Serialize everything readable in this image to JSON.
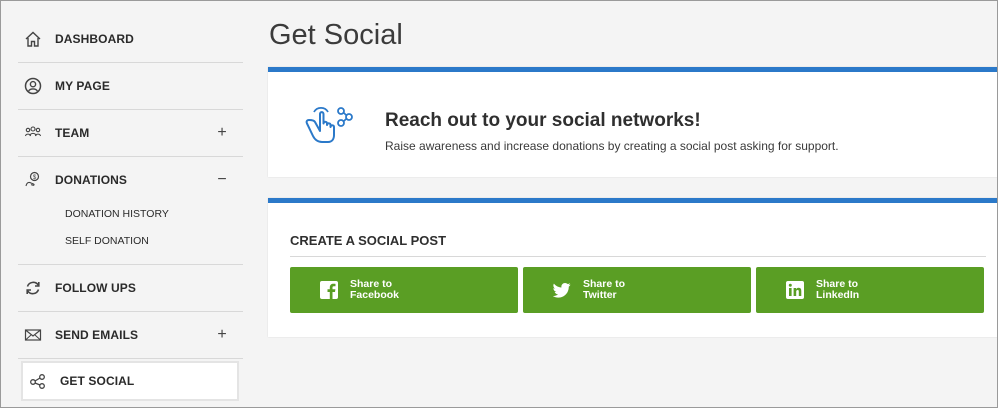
{
  "sidebar": {
    "items": [
      {
        "label": "DASHBOARD",
        "icon": "home-icon"
      },
      {
        "label": "MY PAGE",
        "icon": "user-circle-icon"
      },
      {
        "label": "TEAM",
        "icon": "team-icon",
        "toggle": "+"
      },
      {
        "label": "DONATIONS",
        "icon": "donation-icon",
        "toggle": "−"
      },
      {
        "label": "FOLLOW UPS",
        "icon": "refresh-icon"
      },
      {
        "label": "SEND EMAILS",
        "icon": "envelope-icon",
        "toggle": "+"
      },
      {
        "label": "GET SOCIAL",
        "icon": "share-icon"
      }
    ],
    "donation_subitems": [
      "DONATION HISTORY",
      "SELF DONATION"
    ]
  },
  "main": {
    "title": "Get Social",
    "reach": {
      "title": "Reach out to your social networks!",
      "subtitle": "Raise awareness and increase donations by creating a social post asking for support."
    },
    "create": {
      "title": "CREATE A SOCIAL POST",
      "buttons": [
        {
          "line1": "Share to",
          "line2": "Facebook",
          "icon": "facebook-icon"
        },
        {
          "line1": "Share to",
          "line2": "Twitter",
          "icon": "twitter-icon"
        },
        {
          "line1": "Share to",
          "line2": "LinkedIn",
          "icon": "linkedin-icon"
        }
      ]
    }
  },
  "colors": {
    "accent_blue": "#2b79c9",
    "share_green": "#5a9e24",
    "sidebar_bg": "#f4f4f4"
  }
}
